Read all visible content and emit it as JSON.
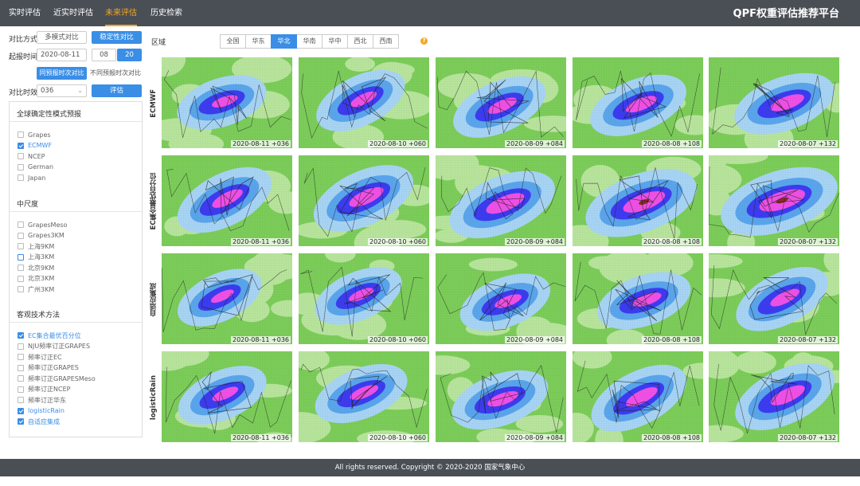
{
  "nav": {
    "tabs": [
      {
        "label": "实时评估"
      },
      {
        "label": "近实时评估"
      },
      {
        "label": "未来评估"
      },
      {
        "label": "历史检索"
      }
    ],
    "active_index": 2,
    "brand": "QPF权重评估推荐平台"
  },
  "controls": {
    "compare_mode_label": "对比方式",
    "multi_model_btn": "多模式对比",
    "stability_btn": "稳定性对比",
    "start_time_label": "起报时间",
    "start_date": "2020-08-11",
    "hour_08": "08",
    "hour_20": "20",
    "same_valid_btn": "同预报时次对比",
    "diff_valid_btn": "不同预报时次对比",
    "lead_label": "对比时效",
    "lead_value": "036",
    "evaluate_btn": "评估"
  },
  "panel": {
    "global_title": "全球确定性模式预报",
    "global_items": [
      {
        "label": "Grapes",
        "checked": false
      },
      {
        "label": "ECMWF",
        "checked": true
      },
      {
        "label": "NCEP",
        "checked": false
      },
      {
        "label": "German",
        "checked": false
      },
      {
        "label": "Japan",
        "checked": false
      }
    ],
    "meso_title": "中尺度",
    "meso_items": [
      {
        "label": "GrapesMeso",
        "checked": false
      },
      {
        "label": "Grapes3KM",
        "checked": false
      },
      {
        "label": "上海9KM",
        "checked": false
      },
      {
        "label": "上海3KM",
        "checked": false,
        "focus": true
      },
      {
        "label": "北京9KM",
        "checked": false
      },
      {
        "label": "北京3KM",
        "checked": false
      },
      {
        "label": "广州3KM",
        "checked": false
      }
    ],
    "obj_title": "客观技术方法",
    "obj_items": [
      {
        "label": "EC集合最优百分位",
        "checked": true
      },
      {
        "label": "NJU频率订正GRAPES",
        "checked": false
      },
      {
        "label": "频率订正EC",
        "checked": false
      },
      {
        "label": "频率订正GRAPES",
        "checked": false
      },
      {
        "label": "频率订正GRAPESMeso",
        "checked": false
      },
      {
        "label": "频率订正NCEP",
        "checked": false
      },
      {
        "label": "频率订正华东",
        "checked": false
      },
      {
        "label": "logisticRain",
        "checked": true
      },
      {
        "label": "自适应集成",
        "checked": true
      }
    ]
  },
  "region": {
    "label": "区域",
    "tabs": [
      "全国",
      "华东",
      "华北",
      "华南",
      "华中",
      "西北",
      "西南"
    ],
    "active_index": 2,
    "help": "?"
  },
  "grid": {
    "rows": [
      {
        "label": "ECMWF",
        "intensity": 0.55
      },
      {
        "label": "EC集合最优百分位",
        "intensity": 0.9
      },
      {
        "label": "自适应集成",
        "intensity": 0.45
      },
      {
        "label": "logisticRain",
        "intensity": 0.6
      }
    ],
    "captions": [
      "2020-08-11 +036",
      "2020-08-10 +060",
      "2020-08-09 +084",
      "2020-08-08 +108",
      "2020-08-07 +132"
    ]
  },
  "colors": {
    "light_blue": "#a8d4f5",
    "mid_blue": "#5aa5ec",
    "blue": "#3c3cf0",
    "magenta": "#f050e6",
    "green": "#7ccd5a",
    "light_green": "#b8e59c",
    "dark_red": "#8b2a2a"
  },
  "footer": "All rights reserved. Copyright © 2020-2020 国家气象中心"
}
